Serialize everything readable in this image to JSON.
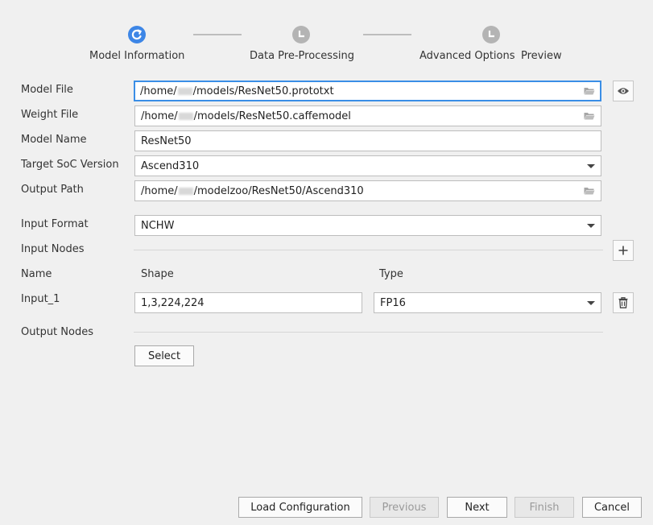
{
  "stepper": {
    "steps": [
      {
        "label": "Model Information",
        "state": "active"
      },
      {
        "label": "Data Pre-Processing",
        "state": "pending"
      },
      {
        "label": "Advanced Options",
        "state": "pending"
      },
      {
        "label": "Preview",
        "state": "pending"
      }
    ]
  },
  "form": {
    "model_file": {
      "label": "Model File",
      "value_prefix": "/home/",
      "value_suffix": "/models/ResNet50.prototxt"
    },
    "weight_file": {
      "label": "Weight File",
      "value_prefix": "/home/",
      "value_suffix": "/models/ResNet50.caffemodel"
    },
    "model_name": {
      "label": "Model Name",
      "value": "ResNet50"
    },
    "target_soc": {
      "label": "Target SoC Version",
      "value": "Ascend310"
    },
    "output_path": {
      "label": "Output Path",
      "value_prefix": "/home/",
      "value_suffix": "/modelzoo/ResNet50/Ascend310"
    },
    "input_format": {
      "label": "Input Format",
      "value": "NCHW"
    },
    "input_nodes": {
      "label": "Input Nodes",
      "headers": {
        "name": "Name",
        "shape": "Shape",
        "type": "Type"
      },
      "rows": [
        {
          "name": "Input_1",
          "shape": "1,3,224,224",
          "type": "FP16"
        }
      ]
    },
    "output_nodes": {
      "label": "Output Nodes",
      "select_label": "Select"
    }
  },
  "footer": {
    "load_config": "Load Configuration",
    "previous": "Previous",
    "next": "Next",
    "finish": "Finish",
    "cancel": "Cancel"
  },
  "colors": {
    "accent": "#3d86e6",
    "step_pending": "#b4b4b4",
    "background": "#f0f0f0"
  }
}
